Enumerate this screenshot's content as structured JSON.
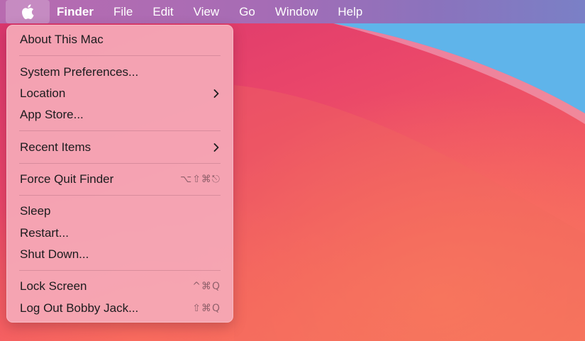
{
  "menubar": {
    "apple_icon": "apple-logo-icon",
    "app_name": "Finder",
    "menus": [
      "File",
      "Edit",
      "View",
      "Go",
      "Window",
      "Help"
    ]
  },
  "apple_menu": {
    "about": "About This Mac",
    "system_preferences": "System Preferences...",
    "location": "Location",
    "app_store": "App Store...",
    "recent_items": "Recent Items",
    "force_quit": "Force Quit Finder",
    "force_quit_shortcut": "⌥⇧⌘⎋",
    "sleep": "Sleep",
    "restart": "Restart...",
    "shut_down": "Shut Down...",
    "lock_screen": "Lock Screen",
    "lock_screen_shortcut": "^⌘Q",
    "log_out": "Log Out Bobby Jack...",
    "log_out_shortcut": "⇧⌘Q",
    "submenu_icon": "chevron-right-icon"
  },
  "colors": {
    "menubar_left": "#b86bb0",
    "menubar_right": "#7a80c6",
    "dropdown_bg": "#f5aab9",
    "wallpaper_red": "#e9456a",
    "wallpaper_blue": "#5fb4ea"
  }
}
